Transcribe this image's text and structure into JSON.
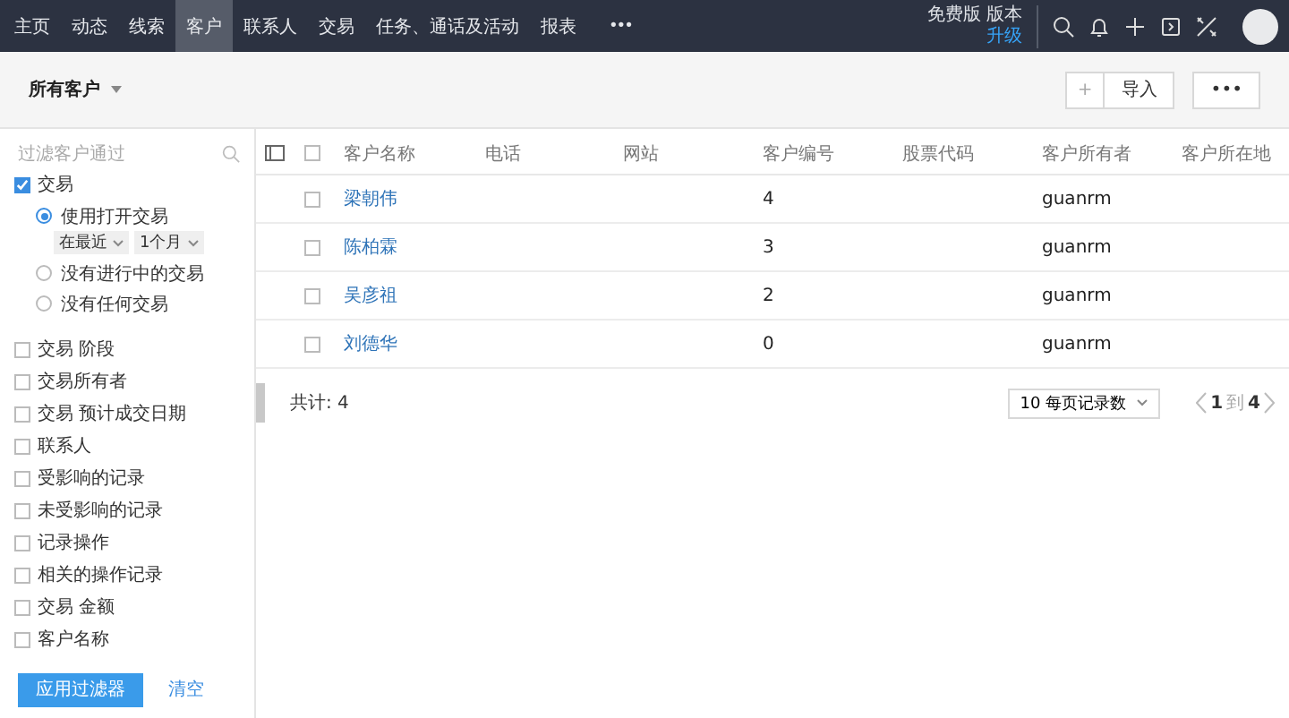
{
  "nav": {
    "items": [
      {
        "label": "主页",
        "selected": false
      },
      {
        "label": "动态",
        "selected": false
      },
      {
        "label": "线索",
        "selected": false
      },
      {
        "label": "客户",
        "selected": true
      },
      {
        "label": "联系人",
        "selected": false
      },
      {
        "label": "交易",
        "selected": false
      },
      {
        "label": "任务、通话及活动",
        "selected": false
      },
      {
        "label": "报表",
        "selected": false
      }
    ],
    "more": "•••",
    "edition": "免费版 版本",
    "upgrade": "升级"
  },
  "header": {
    "title": "所有客户",
    "add": "+",
    "import": "导入",
    "more": "•••"
  },
  "sidebar": {
    "placeholder": "过滤客户通过",
    "filters": [
      {
        "label": "交易",
        "checked": true,
        "options": [
          {
            "label": "使用打开交易",
            "selected": true,
            "selects": [
              "在最近",
              "1个月"
            ]
          },
          {
            "label": "没有进行中的交易",
            "selected": false
          },
          {
            "label": "没有任何交易",
            "selected": false
          }
        ]
      },
      {
        "label": "交易 阶段",
        "checked": false
      },
      {
        "label": "交易所有者",
        "checked": false
      },
      {
        "label": "交易 预计成交日期",
        "checked": false
      },
      {
        "label": "联系人",
        "checked": false
      },
      {
        "label": "受影响的记录",
        "checked": false
      },
      {
        "label": "未受影响的记录",
        "checked": false
      },
      {
        "label": "记录操作",
        "checked": false
      },
      {
        "label": "相关的操作记录",
        "checked": false
      },
      {
        "label": "交易 金额",
        "checked": false
      },
      {
        "label": "客户名称",
        "checked": false
      }
    ],
    "apply": "应用过滤器",
    "clear": "清空"
  },
  "table": {
    "select_all": false,
    "columns": [
      "客户名称",
      "电话",
      "网站",
      "客户编号",
      "股票代码",
      "客户所有者",
      "客户所在地"
    ],
    "rows": [
      {
        "checked": false,
        "name": "梁朝伟",
        "number": "4",
        "owner": "guanrm"
      },
      {
        "checked": false,
        "name": "陈柏霖",
        "number": "3",
        "owner": "guanrm"
      },
      {
        "checked": false,
        "name": "吴彦祖",
        "number": "2",
        "owner": "guanrm"
      },
      {
        "checked": false,
        "name": "刘德华",
        "number": "0",
        "owner": "guanrm"
      }
    ]
  },
  "footer": {
    "total": "共计: 4",
    "page_size": "10 每页记录数",
    "page": "1",
    "separator": "到",
    "pages": "4"
  }
}
